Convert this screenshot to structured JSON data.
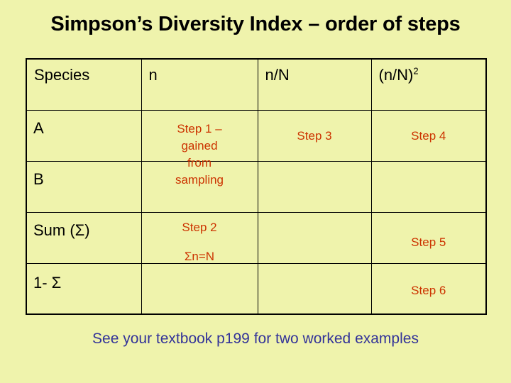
{
  "slide": {
    "title": "Simpson’s Diversity Index – order of steps",
    "background_color": "#eff3ac",
    "title_color": "#000000",
    "caption": "See your textbook p199 for two worked examples",
    "caption_color": "#333399",
    "step_color": "#cc3300",
    "border_color": "#000000"
  },
  "table": {
    "headers": [
      {
        "label": "Species"
      },
      {
        "label": "n"
      },
      {
        "label": "n/N"
      },
      {
        "label_base": "(n/N)",
        "label_sup": "2"
      }
    ],
    "rows": [
      {
        "label": "A",
        "n": "Step 1 – gained from sampling",
        "n_lines": [
          "Step 1 –",
          "gained",
          "from",
          "sampling"
        ],
        "nN": "Step 3",
        "nN2": "Step 4"
      },
      {
        "label": "B",
        "n": "",
        "nN": "",
        "nN2": ""
      },
      {
        "label": "Sum (Σ)",
        "n": "Step 2",
        "n_secondary": "Σn=N",
        "nN": "",
        "nN2": "Step 5"
      },
      {
        "label": "1- Σ",
        "n": "",
        "nN": "",
        "nN2": "Step 6"
      }
    ]
  }
}
